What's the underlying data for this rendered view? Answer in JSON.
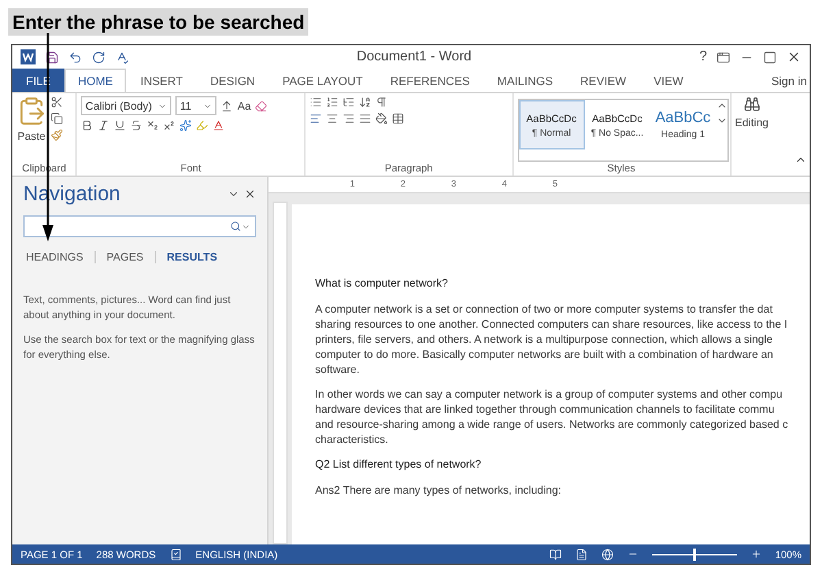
{
  "annotation": {
    "text": "Enter the phrase to be searched"
  },
  "window": {
    "title": "Document1 - Word",
    "help": "?"
  },
  "tabs": [
    {
      "label": "FILE",
      "kind": "file",
      "selected": false
    },
    {
      "label": "HOME",
      "kind": "tab",
      "selected": true
    },
    {
      "label": "INSERT",
      "kind": "tab",
      "selected": false
    },
    {
      "label": "DESIGN",
      "kind": "tab",
      "selected": false
    },
    {
      "label": "PAGE LAYOUT",
      "kind": "tab",
      "selected": false
    },
    {
      "label": "REFERENCES",
      "kind": "tab",
      "selected": false
    },
    {
      "label": "MAILINGS",
      "kind": "tab",
      "selected": false
    },
    {
      "label": "REVIEW",
      "kind": "tab",
      "selected": false
    },
    {
      "label": "VIEW",
      "kind": "tab",
      "selected": false
    }
  ],
  "sign_in": "Sign in",
  "ribbon": {
    "paste": "Paste",
    "font_name": "Calibri (Body)",
    "font_size": "11",
    "change_case": "Aa",
    "editing": "Editing",
    "styles": [
      {
        "preview": "AaBbCcDc",
        "name": "¶ Normal",
        "kind": "body",
        "selected": true
      },
      {
        "preview": "AaBbCcDc",
        "name": "¶ No Spac...",
        "kind": "body",
        "selected": false
      },
      {
        "preview": "AaBbCc",
        "name": "Heading 1",
        "kind": "heading",
        "selected": false
      }
    ],
    "groups": [
      "Clipboard",
      "Font",
      "Paragraph",
      "Styles"
    ]
  },
  "navigation": {
    "title": "Navigation",
    "tabs": [
      {
        "label": "HEADINGS",
        "selected": false
      },
      {
        "label": "PAGES",
        "selected": false
      },
      {
        "label": "RESULTS",
        "selected": true
      }
    ],
    "hints": [
      "Text, comments, pictures... Word can find just about anything in your document.",
      "Use the search box for text or the magnifying glass for everything else."
    ]
  },
  "ruler": [
    "1",
    "2",
    "3",
    "4",
    "5"
  ],
  "document": {
    "blocks": [
      {
        "kind": "heading",
        "lines": [
          "What is computer network?"
        ]
      },
      {
        "kind": "paragraph",
        "lines": [
          "A computer network is a set or connection of two or more computer systems to transfer the dat",
          "sharing resources to one another. Connected computers can share resources, like access to the I",
          "printers, file servers, and others. A network is a multipurpose connection, which allows a single",
          "computer to do more. Basically computer networks are built with a combination of hardware an",
          "software."
        ]
      },
      {
        "kind": "paragraph",
        "lines": [
          "In other words we can say a computer network is a group of computer systems and other compu",
          "hardware devices that are linked together through communication channels to facilitate commu",
          "and resource-sharing among a wide range of users. Networks are commonly categorized based c",
          "characteristics."
        ]
      },
      {
        "kind": "heading",
        "lines": [
          "Q2 List different types of network?"
        ]
      },
      {
        "kind": "paragraph",
        "lines": [
          "Ans2 There are many types of networks, including:"
        ]
      }
    ]
  },
  "status_bar": {
    "page": "PAGE 1 OF 1",
    "words": "288 WORDS",
    "language": "ENGLISH (INDIA)",
    "zoom": "100%",
    "zoom_level": {
      "level": 0.5
    }
  }
}
